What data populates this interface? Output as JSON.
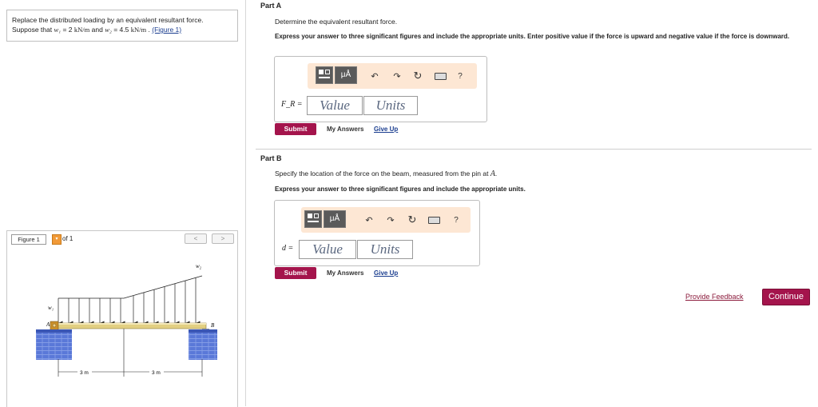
{
  "problem": {
    "line1": "Replace the distributed loading by an equivalent resultant force.",
    "line2_pre": "Suppose that",
    "w1_sym": "w₁",
    "w1_eq": "= 2",
    "w1_unit": "kN/m",
    "and": "and",
    "w2_sym": "w₂",
    "w2_eq": "= 4.5",
    "w2_unit": "kN/m",
    "period": ".",
    "figure_link": "(Figure 1)"
  },
  "figure": {
    "label": "Figure 1",
    "of": "of 1",
    "prev": "<",
    "next": ">",
    "labels": {
      "w1": "w₁",
      "w2": "w₂",
      "A": "A",
      "B": "B",
      "d1": "3 m",
      "d2": "3 m"
    }
  },
  "partA": {
    "title": "Part A",
    "prompt": "Determine the equivalent resultant force.",
    "instruction": "Express your answer to three significant figures and include the appropriate units. Enter positive value if the force is upward and negative value if the force is downward.",
    "var_label": "F_R =",
    "value_placeholder": "Value",
    "units_placeholder": "Units",
    "submit": "Submit",
    "my_answers": "My Answers",
    "give_up": "Give Up"
  },
  "partB": {
    "title": "Part B",
    "prompt_pre": "Specify the location of the force on the beam, measured from the pin at",
    "prompt_var": "A",
    "prompt_post": ".",
    "instruction": "Express your answer to three significant figures and include the appropriate units.",
    "var_label": "d =",
    "value_placeholder": "Value",
    "units_placeholder": "Units",
    "submit": "Submit",
    "my_answers": "My Answers",
    "give_up": "Give Up"
  },
  "toolbar": {
    "mu_label": "μÅ",
    "help": "?"
  },
  "footer": {
    "feedback": "Provide Feedback",
    "continue": "Continue"
  },
  "colors": {
    "accent": "#a4144c",
    "toolbar_bg": "#fde7d4",
    "link": "#1a3d8f",
    "wall": "#4f6fd6",
    "beam": "#e2cf82"
  }
}
